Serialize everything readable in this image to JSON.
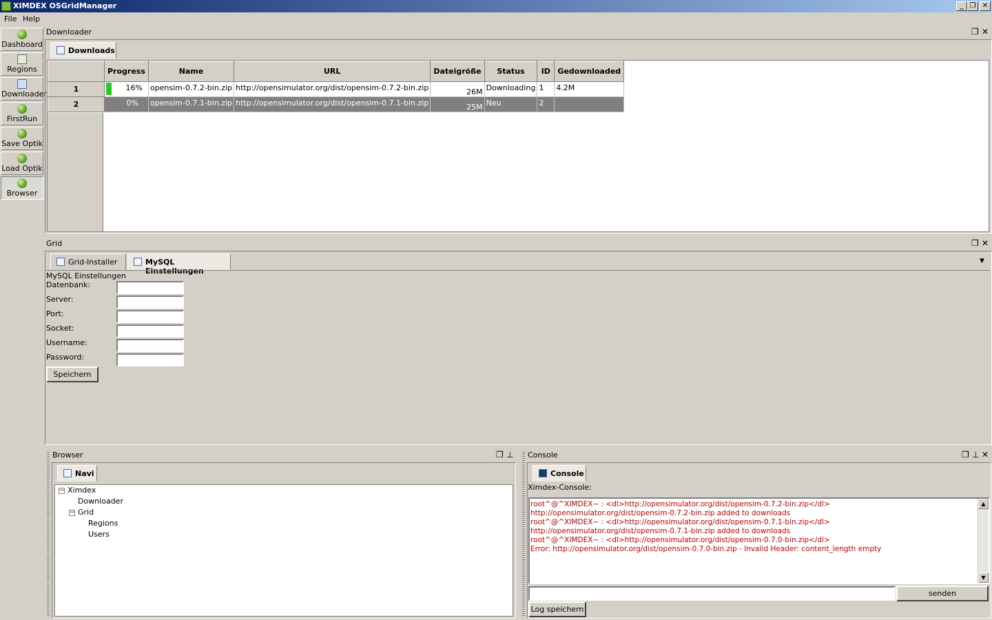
{
  "window": {
    "title": "XIMDEX OSGridManager",
    "minimize": "_",
    "restore": "❐",
    "close": "✕"
  },
  "menu": [
    "File",
    "Help"
  ],
  "toolbar": [
    {
      "label": "Dashboard",
      "icon": "globe-icon"
    },
    {
      "label": "Regions",
      "icon": "map-icon"
    },
    {
      "label": "Downloader",
      "icon": "download-icon"
    },
    {
      "label": "FirstRun",
      "icon": "globe-icon"
    },
    {
      "label": "Save Optik",
      "icon": "globe-icon"
    },
    {
      "label": "Load Optik",
      "icon": "globe-icon"
    },
    {
      "label": "Browser",
      "icon": "globe-icon",
      "active": true
    }
  ],
  "downloader": {
    "panel_title": "Downloader",
    "tab": "Downloads",
    "columns": [
      "Progress",
      "Name",
      "URL",
      "Dateigröße",
      "Status",
      "ID",
      "Gedownloaded"
    ],
    "rows": [
      {
        "row": "1",
        "progress": "16%",
        "progress_value": 0.16,
        "name": "opensim-0.7.2-bin.zip",
        "url": "http://opensimulator.org/dist/opensim-0.7.2-bin.zip",
        "size": "26M",
        "status": "Downloading",
        "id": "1",
        "downloaded": "4.2M"
      },
      {
        "row": "2",
        "progress": "0%",
        "progress_value": 0,
        "name": "opensim-0.7.1-bin.zip",
        "url": "http://opensimulator.org/dist/opensim-0.7.1-bin.zip",
        "size": "25M",
        "status": "Neu",
        "id": "2",
        "downloaded": ""
      }
    ]
  },
  "grid": {
    "panel_title": "Grid",
    "tabs": [
      "Grid-Installer",
      "MySQL Einstellungen"
    ],
    "section_title": "MySQL Einstellungen",
    "fields": [
      "Datenbank:",
      "Server:",
      "Port:",
      "Socket:",
      "Username:",
      "Password:"
    ],
    "save_button": "Speichern"
  },
  "browser": {
    "panel_title": "Browser",
    "tab": "Navi",
    "tree": {
      "root": "Ximdex",
      "root_toggle": "−",
      "downloader": "Downloader",
      "grid": "Grid",
      "grid_toggle": "−",
      "regions": "Regions",
      "users": "Users"
    }
  },
  "console": {
    "panel_title": "Console",
    "tab": "Console",
    "label": "Ximdex-Console:",
    "lines": [
      "root^@^XIMDEX~ :  <dl>http://opensimulator.org/dist/opensim-0.7.2-bin.zip</dl>",
      "http://opensimulator.org/dist/opensim-0.7.2-bin.zip added to downloads",
      "root^@^XIMDEX~ :  <dl>http://opensimulator.org/dist/opensim-0.7.1-bin.zip</dl>",
      "http://opensimulator.org/dist/opensim-0.7.1-bin.zip added to downloads",
      "root^@^XIMDEX~ :  <dl>http://opensimulator.org/dist/opensim-0.7.0-bin.zip</dl>",
      "Error: http://opensimulator.org/dist/opensim-0.7.0-bin.zip - Invalid Header: content_length empty"
    ],
    "send_button": "senden",
    "log_button": "Log speichern",
    "input_value": ""
  },
  "colors": {
    "progress_fill": "#22cc22",
    "console_text": "#c00000",
    "selected_row": "#808080"
  }
}
